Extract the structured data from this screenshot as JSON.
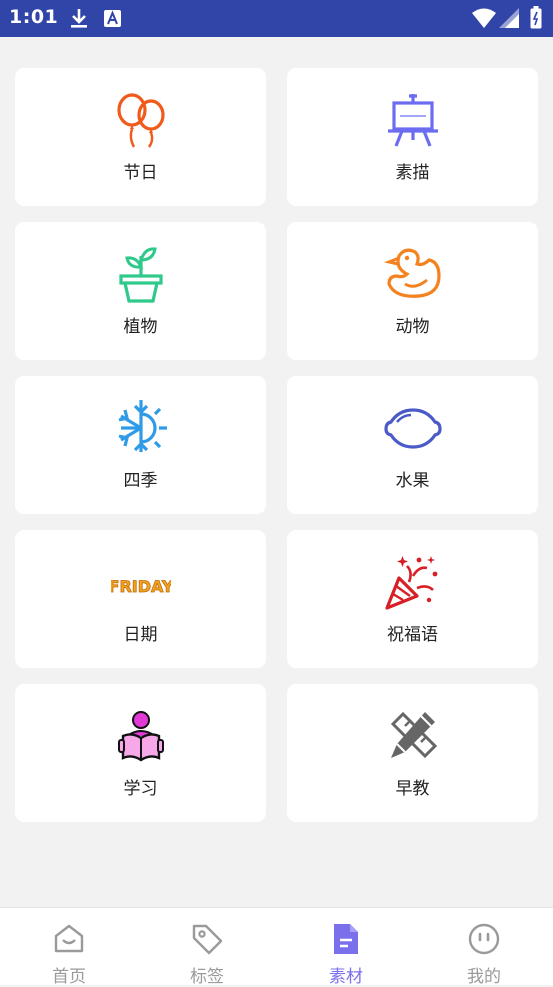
{
  "status_bar": {
    "time": "1:01"
  },
  "categories": [
    {
      "label": "节日",
      "icon": "balloons-icon"
    },
    {
      "label": "素描",
      "icon": "easel-icon"
    },
    {
      "label": "植物",
      "icon": "plant-pot-icon"
    },
    {
      "label": "动物",
      "icon": "duck-icon"
    },
    {
      "label": "四季",
      "icon": "sun-snowflake-icon"
    },
    {
      "label": "水果",
      "icon": "lemon-icon"
    },
    {
      "label": "日期",
      "icon": "friday-text-icon",
      "icon_text": "FRIDAY"
    },
    {
      "label": "祝福语",
      "icon": "party-popper-icon"
    },
    {
      "label": "学习",
      "icon": "reading-person-icon"
    },
    {
      "label": "早教",
      "icon": "pencil-ruler-icon"
    }
  ],
  "bottom_nav": {
    "active_color": "#7b70ec",
    "inactive_color": "#9a9a9a",
    "items": [
      {
        "label": "首页",
        "icon": "home-icon"
      },
      {
        "label": "标签",
        "icon": "tag-icon"
      },
      {
        "label": "素材",
        "icon": "document-icon",
        "active": true
      },
      {
        "label": "我的",
        "icon": "face-icon"
      }
    ]
  }
}
